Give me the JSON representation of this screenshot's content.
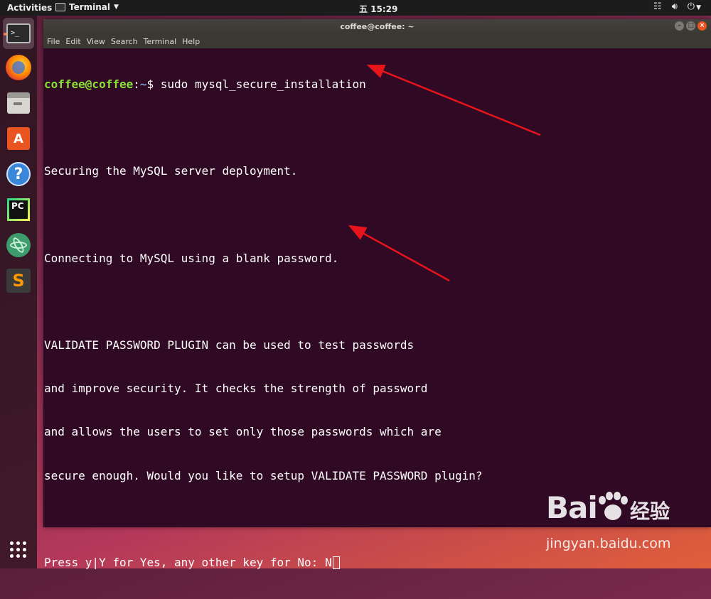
{
  "topbar": {
    "activities": "Activities",
    "app_menu": "Terminal",
    "clock": "五 15:29"
  },
  "dock": {
    "apps": [
      "Terminal",
      "Firefox",
      "Files",
      "Ubuntu Software",
      "Help",
      "PyCharm",
      "Atom",
      "Sublime Text"
    ]
  },
  "window": {
    "title": "coffee@coffee: ~",
    "menu": [
      "File",
      "Edit",
      "View",
      "Search",
      "Terminal",
      "Help"
    ]
  },
  "terminal": {
    "prompt_user": "coffee@coffee",
    "prompt_sep": ":",
    "prompt_path": "~",
    "prompt_symbol": "$ ",
    "command": "sudo mysql_secure_installation",
    "lines": [
      "",
      "Securing the MySQL server deployment.",
      "",
      "Connecting to MySQL using a blank password.",
      "",
      "VALIDATE PASSWORD PLUGIN can be used to test passwords",
      "and improve security. It checks the strength of password",
      "and allows the users to set only those passwords which are",
      "secure enough. Would you like to setup VALIDATE PASSWORD plugin?",
      ""
    ],
    "question": "Press y|Y for Yes, any other key for No: ",
    "answer": "N"
  },
  "annotations": {
    "arrow_color": "#e8141c"
  },
  "watermark": {
    "logo_text": "Bai",
    "logo_suffix": "经验",
    "url": "jingyan.baidu.com"
  },
  "colors": {
    "terminal_bg": "#300a24",
    "prompt_user": "#8ae234",
    "prompt_path": "#729fcf",
    "accent": "#e95420"
  }
}
